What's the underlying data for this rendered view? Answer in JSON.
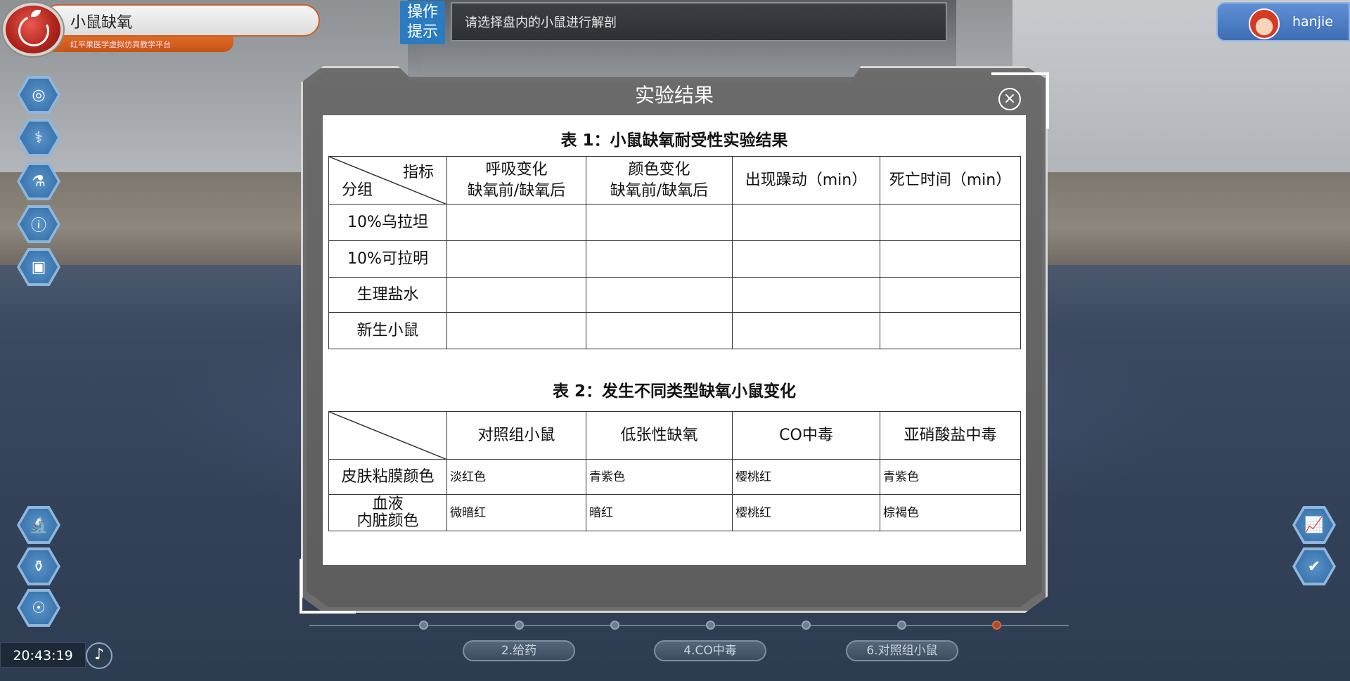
{
  "app": {
    "title": "小鼠缺氧",
    "subtitle": "红平果医学虚拟仿真教学平台"
  },
  "hint": {
    "badge_line1": "操作",
    "badge_line2": "提示",
    "text": "请选择盘内的小鼠进行解剖"
  },
  "user": {
    "name": "hanjie"
  },
  "clock": "20:43:19",
  "modal": {
    "title": "实验结果",
    "close_symbol": "×"
  },
  "table1": {
    "caption": "表 1：小鼠缺氧耐受性实验结果",
    "corner_top": "指标",
    "corner_bottom": "分组",
    "headers": [
      {
        "line1": "呼吸变化",
        "line2": "缺氧前/缺氧后"
      },
      {
        "line1": "颜色变化",
        "line2": "缺氧前/缺氧后"
      },
      {
        "line1": "出现躁动（min）",
        "line2": ""
      },
      {
        "line1": "死亡时间（min）",
        "line2": ""
      }
    ],
    "rows": [
      {
        "group": "10%乌拉坦",
        "cells": [
          "",
          "",
          "",
          ""
        ]
      },
      {
        "group": "10%可拉明",
        "cells": [
          "",
          "",
          "",
          ""
        ]
      },
      {
        "group": "生理盐水",
        "cells": [
          "",
          "",
          "",
          ""
        ]
      },
      {
        "group": "新生小鼠",
        "cells": [
          "",
          "",
          "",
          ""
        ]
      }
    ]
  },
  "table2": {
    "caption": "表 2：发生不同类型缺氧小鼠变化",
    "headers": [
      "对照组小鼠",
      "低张性缺氧",
      "CO中毒",
      "亚硝酸盐中毒"
    ],
    "rows": [
      {
        "label": "皮肤粘膜颜色",
        "label2": "",
        "cells": [
          "淡红色",
          "青紫色",
          "樱桃红",
          "青紫色"
        ]
      },
      {
        "label": "血液",
        "label2": "内脏颜色",
        "cells": [
          "微暗红",
          "暗红",
          "樱桃红",
          "棕褐色"
        ]
      }
    ]
  },
  "timeline": {
    "labels": [
      "2.给药",
      "4.CO中毒",
      "6.对照组小鼠"
    ],
    "active_step": 7,
    "step_count": 7
  },
  "left_icons": [
    "target-icon",
    "dna-icon",
    "flask-icon",
    "info-icon",
    "report-icon",
    "microscope-icon",
    "bottle-icon",
    "hand-care-icon"
  ],
  "right_icons": [
    "chart-icon",
    "clipboard-check-icon"
  ]
}
